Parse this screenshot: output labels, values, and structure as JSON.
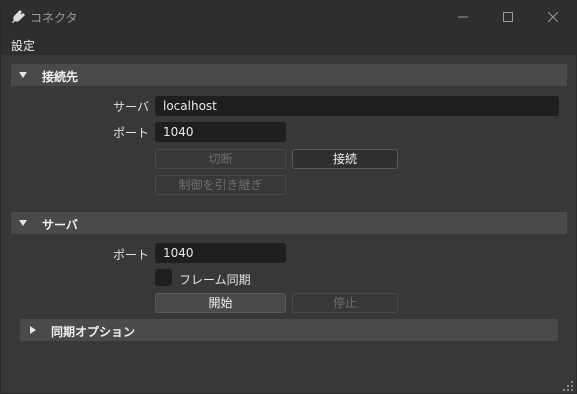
{
  "window": {
    "title": "コネクタ",
    "icon": "plug-icon"
  },
  "menubar": {
    "settings_label": "設定"
  },
  "connection": {
    "header": "接続先",
    "server_label": "サーバ",
    "server_value": "localhost",
    "port_label": "ポート",
    "port_value": "1040",
    "disconnect_label": "切断",
    "connect_label": "接続",
    "takeover_label": "制御を引き継ぎ"
  },
  "server": {
    "header": "サーバ",
    "port_label": "ポート",
    "port_value": "1040",
    "frame_sync_label": "フレーム同期",
    "frame_sync_checked": false,
    "start_label": "開始",
    "stop_label": "停止"
  },
  "sync_options": {
    "header": "同期オプション",
    "expanded": false
  },
  "colors": {
    "background": "#383838",
    "titlebar": "#2e2e2e",
    "section_header": "#4a4a4a",
    "input_bg": "#1f1f1f",
    "text": "#e6e6e6",
    "disabled_text": "#6e6e6e"
  }
}
